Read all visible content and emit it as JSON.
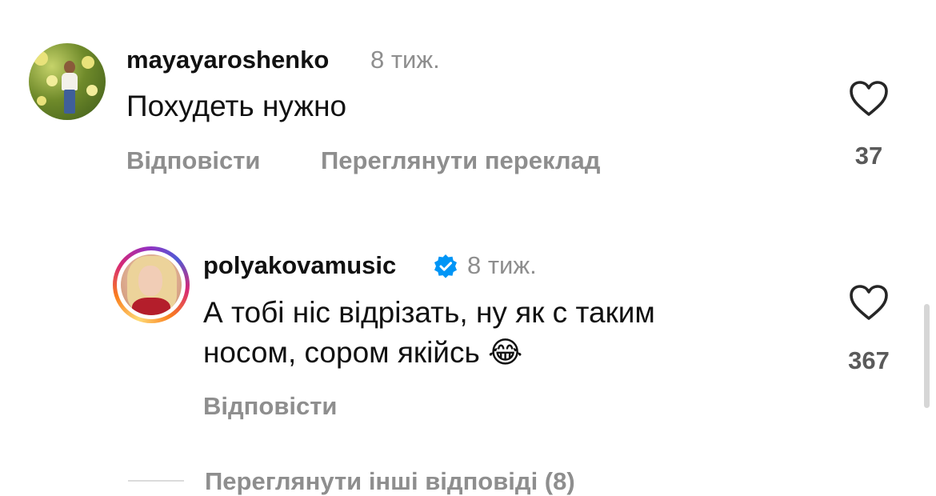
{
  "comments": [
    {
      "username": "mayayaroshenko",
      "time": "8 тиж.",
      "text": "Похудеть нужно",
      "reply_label": "Відповісти",
      "translate_label": "Переглянути переклад",
      "likes": "37",
      "verified": false,
      "avatar_icon": "profile-photo-icon"
    },
    {
      "username": "polyakovamusic",
      "time": "8 тиж.",
      "text_line1": "А тобі ніс відрізать, ну як с таким",
      "text_line2": "носом, сором якійсь",
      "emoji": "😂",
      "reply_label": "Відповісти",
      "likes": "367",
      "verified": true,
      "avatar_icon": "profile-photo-story-ring-icon"
    }
  ],
  "view_more_replies_label": "Переглянути інші відповіді (8)",
  "icons": {
    "like": "heart-outline-icon",
    "verified": "verified-badge-icon"
  },
  "colors": {
    "username": "#111111",
    "secondary_text": "#8e8e8e",
    "like_count": "#5a5a5a",
    "verified_blue": "#0095f6",
    "divider": "#dbdbdb"
  }
}
